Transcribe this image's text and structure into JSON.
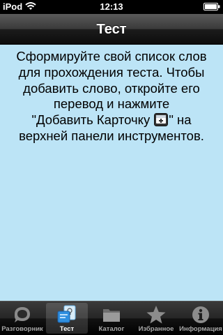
{
  "status_bar": {
    "carrier": "iPod",
    "time": "12:13"
  },
  "nav_bar": {
    "title": "Тест"
  },
  "content": {
    "line_1": "Сформируйте свой список слов для прохождения теста. Чтобы добавить слово, откройте его перевод и нажмите",
    "line_2_before_icon": "\"Добавить Карточку ",
    "line_2_after_icon": "\" на верхней панели инструментов.",
    "inline_icon": "add-card-icon"
  },
  "tab_bar": {
    "selected_tab": "Тест",
    "tabs": [
      {
        "label": "Разговорник",
        "icon": "phrasebook-icon"
      },
      {
        "label": "Тест",
        "icon": "test-cards-icon"
      },
      {
        "label": "Каталог",
        "icon": "folder-icon"
      },
      {
        "label": "Избранное",
        "icon": "star-icon"
      },
      {
        "label": "Информация",
        "icon": "info-icon"
      }
    ]
  },
  "colors": {
    "content_background": "#bce4f6",
    "text": "#000000",
    "tab_label_selected": "#ffffff",
    "tab_label_inactive": "#a8a8a8"
  }
}
